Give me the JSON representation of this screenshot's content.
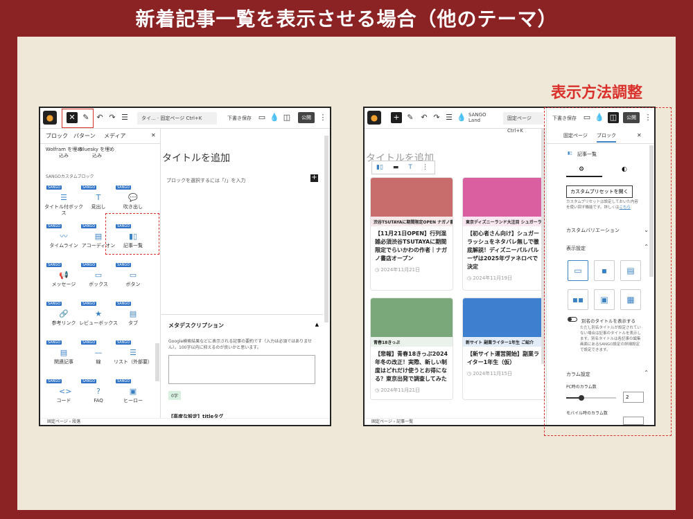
{
  "title": "新着記事一覧を表示させる場合（他のテーマ）",
  "callout_label": "表示方法調整",
  "colors": {
    "frame": "#8b2223",
    "panel": "#efe8d8",
    "accent": "#d9302b",
    "blue": "#3b82c4"
  },
  "left": {
    "doc_title": "タイ... · 固定ページ",
    "shortcut": "Ctrl+K",
    "draft": "下書き保存",
    "publish": "公開",
    "tabs": [
      "ブロック",
      "パターン",
      "メディア"
    ],
    "top_items": [
      "Wolfram を埋め込み",
      "Bluesky を埋め込み"
    ],
    "section": "SANGOカスタムブロック",
    "badge": "SANGO",
    "blocks": [
      "タイトル付ボックス",
      "見出し",
      "吹き出し",
      "タイムライン",
      "アコーディオン",
      "記事一覧",
      "メッセージ",
      "ボックス",
      "ボタン",
      "参考リンク",
      "レビューボックス",
      "タブ",
      "関連記事",
      "線",
      "リスト（外部要）",
      "コード",
      "FAQ",
      "ヒーロー"
    ],
    "editor_title": "タイトルを追加",
    "editor_hint": "ブロックを選択するには「/」を入力",
    "meta_title": "メタデスクリプション",
    "meta_desc": "Google検索結果などに表示される記事の要約です（入力は必須ではありません）。100字以内に抑えるのが良いかと思います。",
    "meta_count": "0字",
    "advanced": "【高度な設定】titleタグ",
    "breadcrumb": "固定ページ › 段落"
  },
  "right": {
    "site": "SANGO Land",
    "doc_title": "固定ページ",
    "shortcut": "Ctrl+K",
    "draft": "下書き保存",
    "publish": "公開",
    "editor_title": "タイトルを追加",
    "cards": [
      {
        "text": "【11月21日OPEN】行列混雑必須渋谷TSUTAYAに期間限定でらいかわの作者｜ナガノ書店オープン",
        "date": "2024年11月21日",
        "img": "#c96c6c",
        "banner": "渋谷TSUTAYAに期間限定OPEN ナガノ書店"
      },
      {
        "text": "【初心者さん向け】シュガーラッシュをネタバレ無しで徹底解説！ディズニーパルパルーザは2025年ヴァネロペで決定",
        "date": "2024年11月19日",
        "img": "#d95fa0",
        "banner": "東京ディズニーランド大注目 シュガーラッシュ"
      },
      {
        "text": "【悲報】青春18きっぷ2024年冬の改正！実際、新しい制度はどれだけ使うとお得になる？東京出発で調査してみた",
        "date": "2024年11月21日",
        "img": "#7aa87a",
        "banner": "青春18きっぷ"
      },
      {
        "text": "【新サイト運営開始】副業ライター1年生（仮）",
        "date": "2024年11月15日",
        "img": "#3f7fd0",
        "banner": "新サイト 副業ライター1年生 ご紹介"
      }
    ],
    "panel_tabs": [
      "固定ページ",
      "ブロック"
    ],
    "block_name": "記事一覧",
    "preset_btn": "カスタムプリセットを開く",
    "preset_note": "カスタムプリセットは設定しておいた内容を使い回す機能です。詳しくは",
    "preset_link": "こちら",
    "variation": "カスタムバリエーション",
    "display": "表示設定",
    "alias_toggle": "別名のタイトルを表示する",
    "alias_note": "ただし別名タイトルが設定されていない場合は記事のタイトルを表示します。別名タイトルは各記事の編集画面にあるSANGO設定の詳細設定で設定できます。",
    "columns": "カラム設定",
    "pc_cols_label": "PC時のカラム数",
    "pc_cols": "2",
    "mobile_cols_label": "モバイル時のカラム数",
    "breadcrumb": "固定ページ › 記事一覧"
  }
}
